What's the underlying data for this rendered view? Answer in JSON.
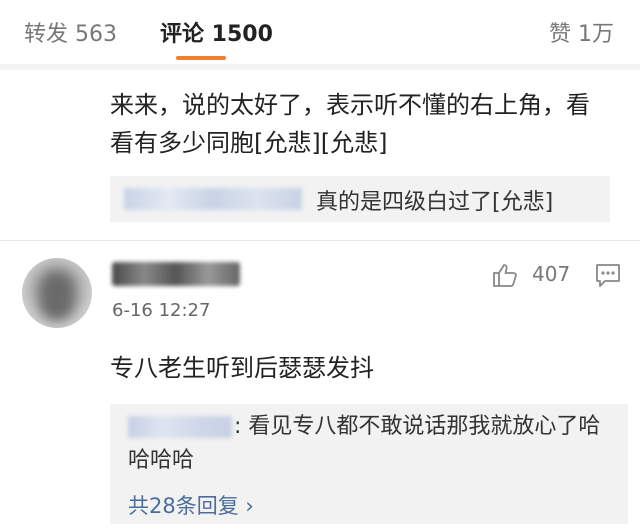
{
  "tabs": {
    "repost": "转发 563",
    "comment": "评论 1500",
    "like": "赞 1万"
  },
  "comment1": {
    "text": "来来，说的太好了，表示听不懂的右上角，看看有多少同胞[允悲][允悲]",
    "reply": {
      "text": "真的是四级白过了[允悲]"
    }
  },
  "comment2": {
    "time": "6-16 12:27",
    "like_count": "407",
    "text": "专八老生听到后瑟瑟发抖",
    "reply": {
      "text": ": 看见专八都不敢说话那我就放心了哈哈哈哈",
      "more": "共28条回复 ›"
    }
  },
  "icons": [
    "like-icon",
    "comment-icon"
  ],
  "colors": {
    "accent": "#f07f32",
    "link": "#4a6d9d"
  }
}
